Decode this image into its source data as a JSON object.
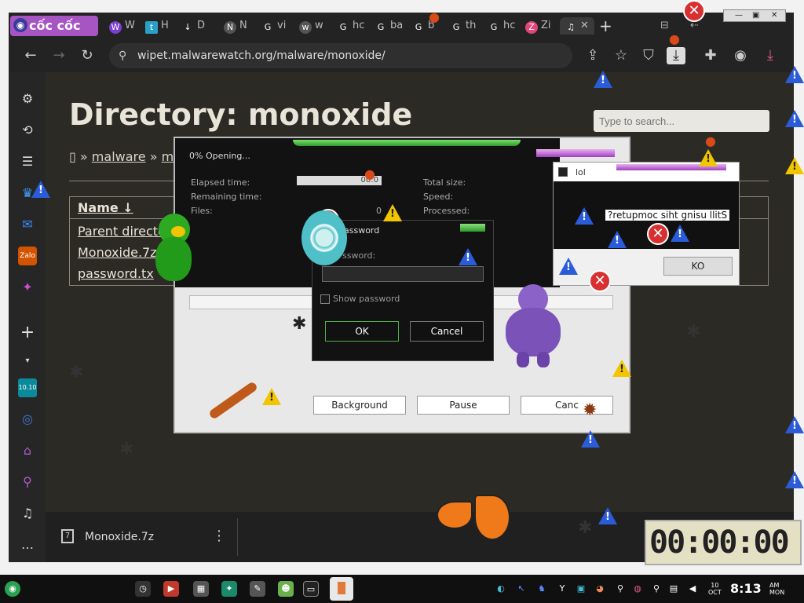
{
  "browser": {
    "brand": "cốc cốc",
    "tabs": [
      {
        "label": "W",
        "icon": "W"
      },
      {
        "label": "H",
        "icon": "t"
      },
      {
        "label": "D",
        "icon": "↓"
      },
      {
        "label": "N",
        "icon": "N"
      },
      {
        "label": "vi",
        "icon": "G"
      },
      {
        "label": "w",
        "icon": "w"
      },
      {
        "label": "hc",
        "icon": "G"
      },
      {
        "label": "ba",
        "icon": "G"
      },
      {
        "label": "b",
        "icon": "G"
      },
      {
        "label": "th",
        "icon": "G"
      },
      {
        "label": "hc",
        "icon": "G"
      },
      {
        "label": "Zi",
        "icon": "Z"
      }
    ],
    "new_tab": "+",
    "url": "wipet.malwarewatch.org/malware/monoxide/"
  },
  "page": {
    "title": "Directory: monoxide",
    "search_placeholder": "Type to search...",
    "breadcrumb": {
      "home": "▯",
      "sep1": "»",
      "malware": "malware",
      "sep2": "»",
      "current": "mo"
    },
    "table": {
      "header": "Name ↓",
      "rows": [
        "Parent director",
        "Monoxide.7z",
        "password.tx"
      ]
    }
  },
  "download_bar": {
    "filename": "Monoxide.7z",
    "menu": "⋮"
  },
  "download_dialog": {
    "heading": "0% Opening...",
    "elapsed_label": "Elapsed time:",
    "remaining_label": "Remaining time:",
    "files_label": "Files:",
    "files_value": "0",
    "elapsed_value": "00:0",
    "total_size_label": "Total size:",
    "speed_label": "Speed:",
    "processed_label": "Processed:",
    "buttons": {
      "background": "Background",
      "pause": "Pause",
      "cancel": "Canc"
    }
  },
  "password_dialog": {
    "title": "assword",
    "label": "ssword:",
    "show_password": "Show password",
    "ok": "OK",
    "cancel": "Cancel"
  },
  "lol_dialog": {
    "title": "lol",
    "message": "?retupmoc siht gnisu llitS",
    "ok": "KO"
  },
  "timer": {
    "value": "00:00:00"
  },
  "taskbar": {
    "time": "8:13",
    "ampm": "AM",
    "day": "MON",
    "date_day": "10",
    "date_month": "OCT"
  },
  "colors": {
    "brand": "#a855c4",
    "page_bg": "#2c2a25",
    "green_accent": "#2d9a2d"
  }
}
